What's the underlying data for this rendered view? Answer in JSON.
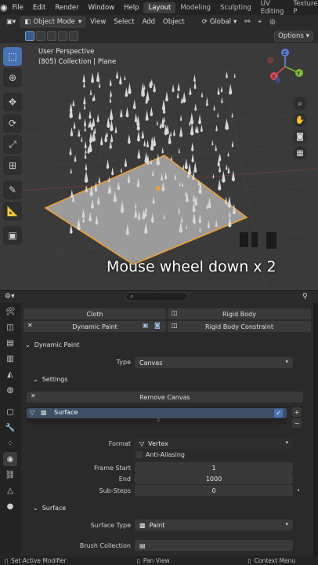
{
  "topbar": {
    "menus": [
      "File",
      "Edit",
      "Render",
      "Window",
      "Help"
    ],
    "workspaces": [
      "Layout",
      "Modeling",
      "Sculpting",
      "UV Editing",
      "Texture P"
    ],
    "active_workspace": "Layout"
  },
  "viewport_header": {
    "mode": "Object Mode",
    "menus": [
      "View",
      "Select",
      "Add",
      "Object"
    ],
    "transform_orientation": "Global",
    "options_label": "Options"
  },
  "viewport": {
    "view_name": "User Perspective",
    "collection_info": "(805) Collection | Plane",
    "overlay_caption": "Mouse wheel down x 2",
    "gizmo_axes": {
      "x": "X",
      "y": "Y",
      "z": "Z"
    }
  },
  "properties": {
    "physics_buttons": {
      "cloth": "Cloth",
      "rigid_body": "Rigid Body",
      "dynamic_paint": "Dynamic Paint",
      "rigid_body_constraint": "Rigid Body Constraint"
    },
    "dynamic_paint_panel": {
      "title": "Dynamic Paint",
      "type_label": "Type",
      "type_value": "Canvas",
      "settings_title": "Settings",
      "remove_canvas": "Remove Canvas",
      "surface_item": "Surface",
      "format_label": "Format",
      "format_value": "Vertex",
      "anti_aliasing": "Anti-Aliasing",
      "frame_start_label": "Frame Start",
      "frame_start_value": "1",
      "end_label": "End",
      "end_value": "1000",
      "substeps_label": "Sub-Steps",
      "substeps_value": "0"
    },
    "surface_panel": {
      "title": "Surface",
      "surface_type_label": "Surface Type",
      "surface_type_value": "Paint",
      "brush_collection_label": "Brush Collection"
    }
  },
  "statusbar": {
    "left": "Set Active Modifier",
    "middle": "Pan View",
    "right": "Context Menu"
  },
  "colors": {
    "accent": "#4772b3",
    "selection_outline": "#f0a030",
    "viewport_bg": "#3a3a3a",
    "panel_bg": "#2a2a2a"
  }
}
